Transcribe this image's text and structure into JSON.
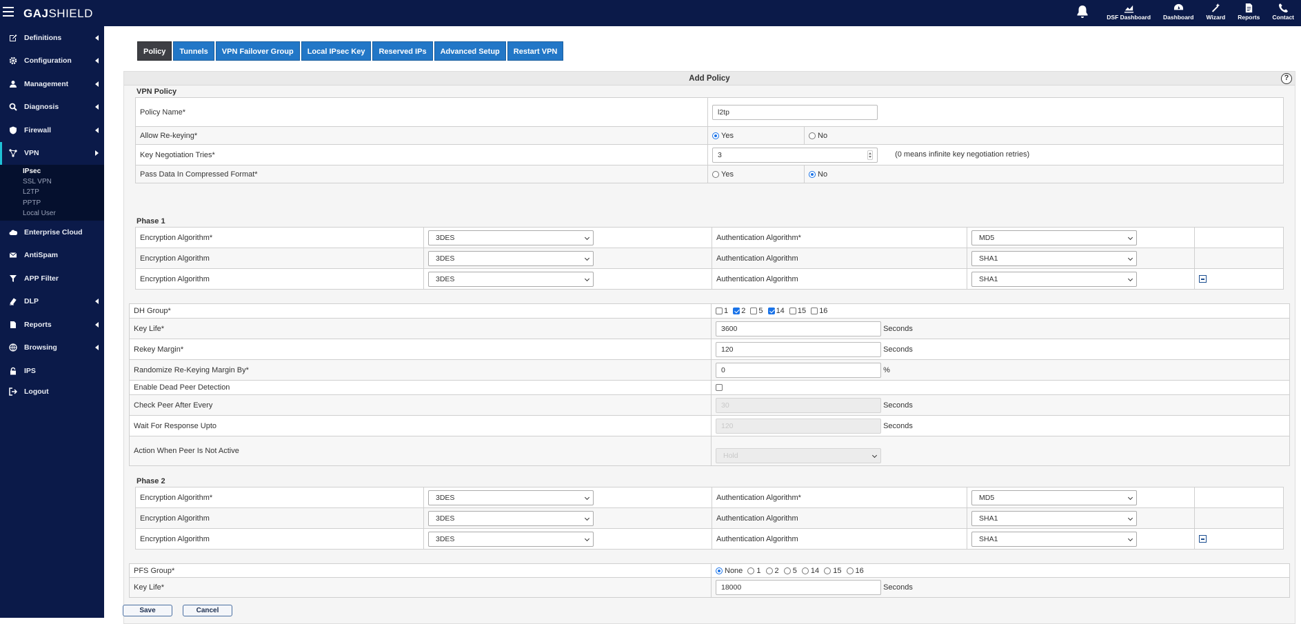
{
  "brand": {
    "bold": "GAJ",
    "rest": "SHIELD"
  },
  "topnav": [
    {
      "label": "DSF Dashboard",
      "icon": "chart-icon"
    },
    {
      "label": "Dashboard",
      "icon": "gauge-icon"
    },
    {
      "label": "Wizard",
      "icon": "wand-icon"
    },
    {
      "label": "Reports",
      "icon": "document-icon"
    },
    {
      "label": "Contact",
      "icon": "phone-icon"
    }
  ],
  "sidebar": {
    "items": [
      {
        "label": "Definitions",
        "icon": "edit-icon"
      },
      {
        "label": "Configuration",
        "icon": "gear-icon"
      },
      {
        "label": "Management",
        "icon": "user-icon"
      },
      {
        "label": "Diagnosis",
        "icon": "search-icon"
      },
      {
        "label": "Firewall",
        "icon": "shield-icon"
      },
      {
        "label": "VPN",
        "icon": "network-icon"
      },
      {
        "label": "Enterprise Cloud",
        "icon": "cloud-icon"
      },
      {
        "label": "AntiSpam",
        "icon": "mail-icon"
      },
      {
        "label": "APP Filter",
        "icon": "filter-icon"
      },
      {
        "label": "DLP",
        "icon": "dlp-icon"
      },
      {
        "label": "Reports",
        "icon": "report-icon"
      },
      {
        "label": "Browsing",
        "icon": "globe-icon"
      },
      {
        "label": "IPS",
        "icon": "lock-icon"
      },
      {
        "label": "Logout",
        "icon": "logout-icon"
      }
    ],
    "vpn_sub": [
      "IPsec",
      "SSL VPN",
      "L2TP",
      "PPTP",
      "Local User"
    ]
  },
  "tabs": [
    "Policy",
    "Tunnels",
    "VPN Failover Group",
    "Local IPsec Key",
    "Reserved IPs",
    "Advanced Setup",
    "Restart VPN"
  ],
  "panel": {
    "title": "Add Policy",
    "help": "?"
  },
  "vpn_policy": {
    "title": "VPN Policy",
    "policy_name_label": "Policy Name*",
    "policy_name_value": "l2tp",
    "rekey_label": "Allow Re-keying*",
    "rekey_yes": "Yes",
    "rekey_no": "No",
    "tries_label": "Key Negotiation Tries*",
    "tries_value": "3",
    "tries_note": "(0 means infinite key negotiation retries)",
    "compress_label": "Pass Data In Compressed Format*",
    "compress_yes": "Yes",
    "compress_no": "No"
  },
  "phase1": {
    "title": "Phase 1",
    "rows": [
      {
        "enc_label": "Encryption Algorithm*",
        "enc": "3DES",
        "auth_label": "Authentication Algorithm*",
        "auth": "MD5"
      },
      {
        "enc_label": "Encryption Algorithm",
        "enc": "3DES",
        "auth_label": "Authentication Algorithm",
        "auth": "SHA1"
      },
      {
        "enc_label": "Encryption Algorithm",
        "enc": "3DES",
        "auth_label": "Authentication Algorithm",
        "auth": "SHA1"
      }
    ]
  },
  "settings": {
    "dh_label": "DH Group*",
    "dh_groups": [
      {
        "label": "1",
        "checked": false
      },
      {
        "label": "2",
        "checked": true
      },
      {
        "label": "5",
        "checked": false
      },
      {
        "label": "14",
        "checked": true
      },
      {
        "label": "15",
        "checked": false
      },
      {
        "label": "16",
        "checked": false
      }
    ],
    "keylife_label": "Key Life*",
    "keylife_value": "3600",
    "rekey_margin_label": "Rekey Margin*",
    "rekey_margin_value": "120",
    "randomize_label": "Randomize Re-Keying Margin By*",
    "randomize_value": "0",
    "percent": "%",
    "dpd_label": "Enable Dead Peer Detection",
    "check_label": "Check Peer After Every",
    "check_value": "30",
    "wait_label": "Wait For Response Upto",
    "wait_value": "120",
    "action_label": "Action When Peer Is Not Active",
    "action_value": "Hold",
    "seconds": "Seconds"
  },
  "phase2": {
    "title": "Phase 2",
    "rows": [
      {
        "enc_label": "Encryption Algorithm*",
        "enc": "3DES",
        "auth_label": "Authentication Algorithm*",
        "auth": "MD5"
      },
      {
        "enc_label": "Encryption Algorithm",
        "enc": "3DES",
        "auth_label": "Authentication Algorithm",
        "auth": "SHA1"
      },
      {
        "enc_label": "Encryption Algorithm",
        "enc": "3DES",
        "auth_label": "Authentication Algorithm",
        "auth": "SHA1"
      }
    ]
  },
  "pfs": {
    "label": "PFS Group*",
    "options": [
      "None",
      "1",
      "2",
      "5",
      "14",
      "15",
      "16"
    ],
    "selected": "None",
    "keylife_label": "Key Life*",
    "keylife_value": "18000"
  },
  "buttons": {
    "save": "Save",
    "cancel": "Cancel"
  }
}
